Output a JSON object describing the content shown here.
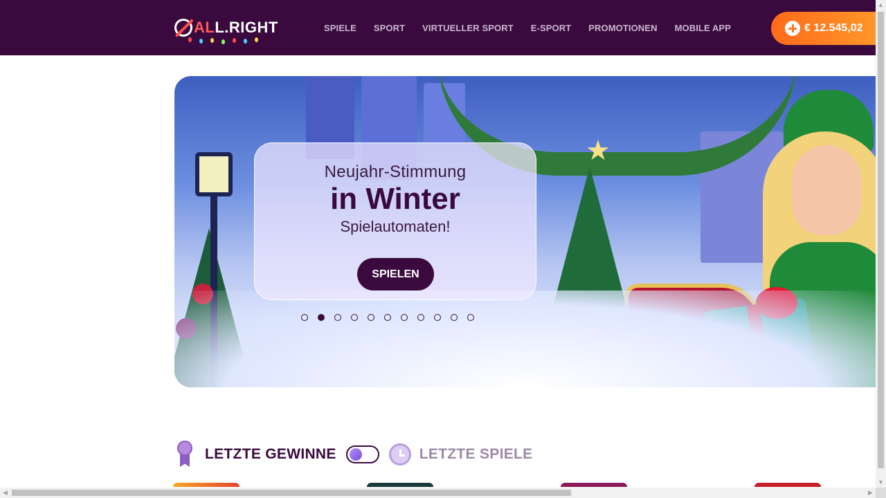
{
  "brand": {
    "logo_prefix": "AL",
    "logo_suffix": "L.RIGHT",
    "logo_alt": "ALLRIGHT"
  },
  "nav": {
    "items": [
      {
        "label": "SPIELE"
      },
      {
        "label": "SPORT"
      },
      {
        "label": "VIRTUELLER SPORT"
      },
      {
        "label": "E-SPORT"
      },
      {
        "label": "PROMOTIONEN"
      },
      {
        "label": "MOBILE APP"
      }
    ]
  },
  "balance": {
    "amount": "€ 12.545,02",
    "icon": "plus-circle-icon"
  },
  "banner": {
    "line1": "Neujahr-Stimmung",
    "line2": "in Winter",
    "line3": "Spielautomaten!",
    "cta": "SPIELEN",
    "slides_total": 11,
    "active_slide": 2
  },
  "recent": {
    "wins_title": "LETZTE GEWINNE",
    "games_title": "LETZTE SPIELE",
    "toggle_state": "wins"
  },
  "colors": {
    "header_bg": "#3a0a3e",
    "accent_orange": "#ff7a20",
    "primary_purple": "#3a0a3e",
    "muted_purple": "#9b8aa6"
  }
}
